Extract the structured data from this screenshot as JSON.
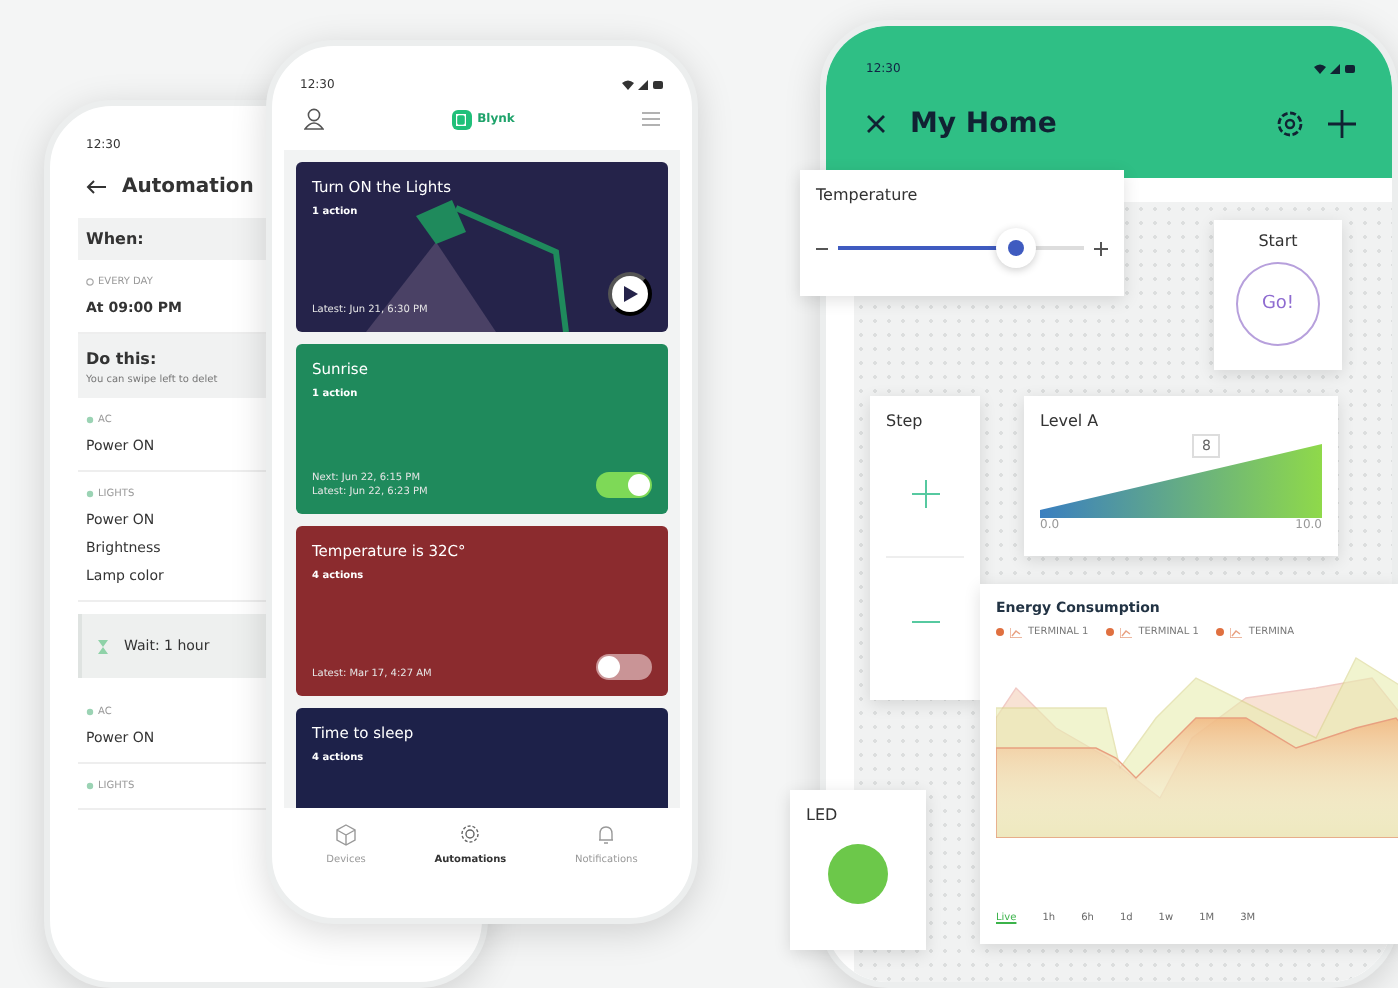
{
  "automation_phone": {
    "status_time": "12:30",
    "title": "Automation",
    "when_heading": "When:",
    "trigger": {
      "caption": "EVERY DAY",
      "value": "At 09:00 PM"
    },
    "do_heading": "Do this:",
    "do_hint": "You can swipe left to delet",
    "actions": [
      {
        "kind": "device",
        "caption": "AC",
        "lines": [
          "Power ON"
        ]
      },
      {
        "kind": "device",
        "caption": "LIGHTS",
        "lines": [
          "Power ON",
          "Brightness",
          "Lamp color"
        ]
      },
      {
        "kind": "wait",
        "lines": [
          "Wait: 1 hour"
        ]
      },
      {
        "kind": "device",
        "caption": "AC",
        "lines": [
          "Power ON"
        ]
      },
      {
        "kind": "device",
        "caption": "LIGHTS"
      }
    ]
  },
  "automations_phone": {
    "status_time": "12:30",
    "brand": "Blynk",
    "cards": [
      {
        "title": "Turn ON the Lights",
        "actions": "1 action",
        "footer": [
          "Latest: Jun 21, 6:30 PM"
        ],
        "color": "#25234a",
        "kind": "play"
      },
      {
        "title": "Sunrise",
        "actions": "1 action",
        "footer": [
          "Next: Jun 22, 6:15 PM",
          "Latest: Jun 22, 6:23 PM"
        ],
        "color": "#1f8a5c",
        "kind": "toggle",
        "on": true
      },
      {
        "title": "Temperature is 32C°",
        "actions": "4 actions",
        "footer": [
          "Latest: Mar 17, 4:27 AM"
        ],
        "color": "#8b2b2e",
        "kind": "toggle",
        "on": false
      },
      {
        "title": "Time to sleep",
        "actions": "4 actions",
        "color": "#1d2149",
        "kind": "plain"
      }
    ],
    "nav": [
      {
        "label": "Devices",
        "selected": false
      },
      {
        "label": "Automations",
        "selected": true
      },
      {
        "label": "Notifications",
        "selected": false
      }
    ]
  },
  "home_phone": {
    "status_time": "12:30",
    "title": "My Home",
    "temperature": {
      "label": "Temperature",
      "level": 0.72
    },
    "start": {
      "label": "Start",
      "button": "Go!"
    },
    "step": {
      "label": "Step"
    },
    "level_a": {
      "label": "Level A",
      "tooltip": "8",
      "min": "0.0",
      "max": "10.0"
    },
    "energy": {
      "title": "Energy Consumption",
      "legend": [
        "TERMINAL 1",
        "TERMINAL 1",
        "TERMINA"
      ],
      "ranges": [
        {
          "label": "Live",
          "selected": true
        },
        {
          "label": "1h",
          "selected": false
        },
        {
          "label": "6h",
          "selected": false
        },
        {
          "label": "1d",
          "selected": false
        },
        {
          "label": "1w",
          "selected": false
        },
        {
          "label": "1M",
          "selected": false
        },
        {
          "label": "3M",
          "selected": false
        }
      ]
    },
    "led": {
      "label": "LED",
      "on": true
    }
  }
}
